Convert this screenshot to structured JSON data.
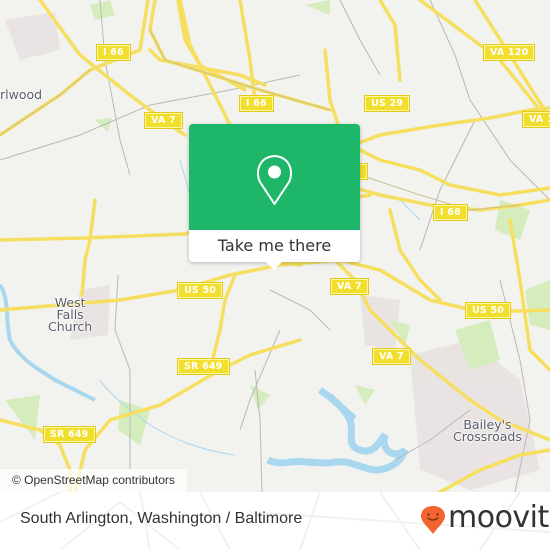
{
  "map": {
    "colors": {
      "land": "#f2f2ef",
      "road_major": "#f6df5f",
      "road_minor": "#b8b8b8",
      "water": "#a8d7ef",
      "park": "#d5ecbd",
      "urban": "#e8e2e0"
    },
    "places": [
      {
        "name": "place-ellwood",
        "text": "rlwood"
      },
      {
        "name": "place-west-falls-church",
        "lines": [
          "West",
          "Falls",
          "Church"
        ]
      },
      {
        "name": "place-baileys-crossroads",
        "lines": [
          "Bailey's",
          "Crossroads"
        ]
      }
    ],
    "shields": [
      {
        "name": "shield-i66-west",
        "text": "I 66"
      },
      {
        "name": "shield-i66-north",
        "text": "I 66"
      },
      {
        "name": "shield-i66-east",
        "text": "I 66"
      },
      {
        "name": "shield-va7-north",
        "text": "VA 7"
      },
      {
        "name": "shield-va7-center",
        "text": "VA 7"
      },
      {
        "name": "shield-va7-south",
        "text": "VA 7"
      },
      {
        "name": "shield-us29",
        "text": "US 29"
      },
      {
        "name": "shield-va120",
        "text": "VA 120"
      },
      {
        "name": "shield-va1x",
        "text": "VA 1"
      },
      {
        "name": "shield-us50-west",
        "text": "US 50"
      },
      {
        "name": "shield-us50-east",
        "text": "US 50"
      },
      {
        "name": "shield-sr649-center",
        "text": "SR 649"
      },
      {
        "name": "shield-sr649-west",
        "text": "SR 649"
      },
      {
        "name": "shield-partial",
        "text": ""
      }
    ],
    "popup": {
      "icon": "map-pin-icon",
      "cta_label": "Take me there",
      "accent": "#1eb76a"
    },
    "attribution": "© OpenStreetMap contributors"
  },
  "footer": {
    "location_title": "South Arlington, Washington / Baltimore",
    "brand": {
      "icon": "moovit-smiley-pin-icon",
      "wordmark": "moovit",
      "color": "#f26430"
    }
  }
}
